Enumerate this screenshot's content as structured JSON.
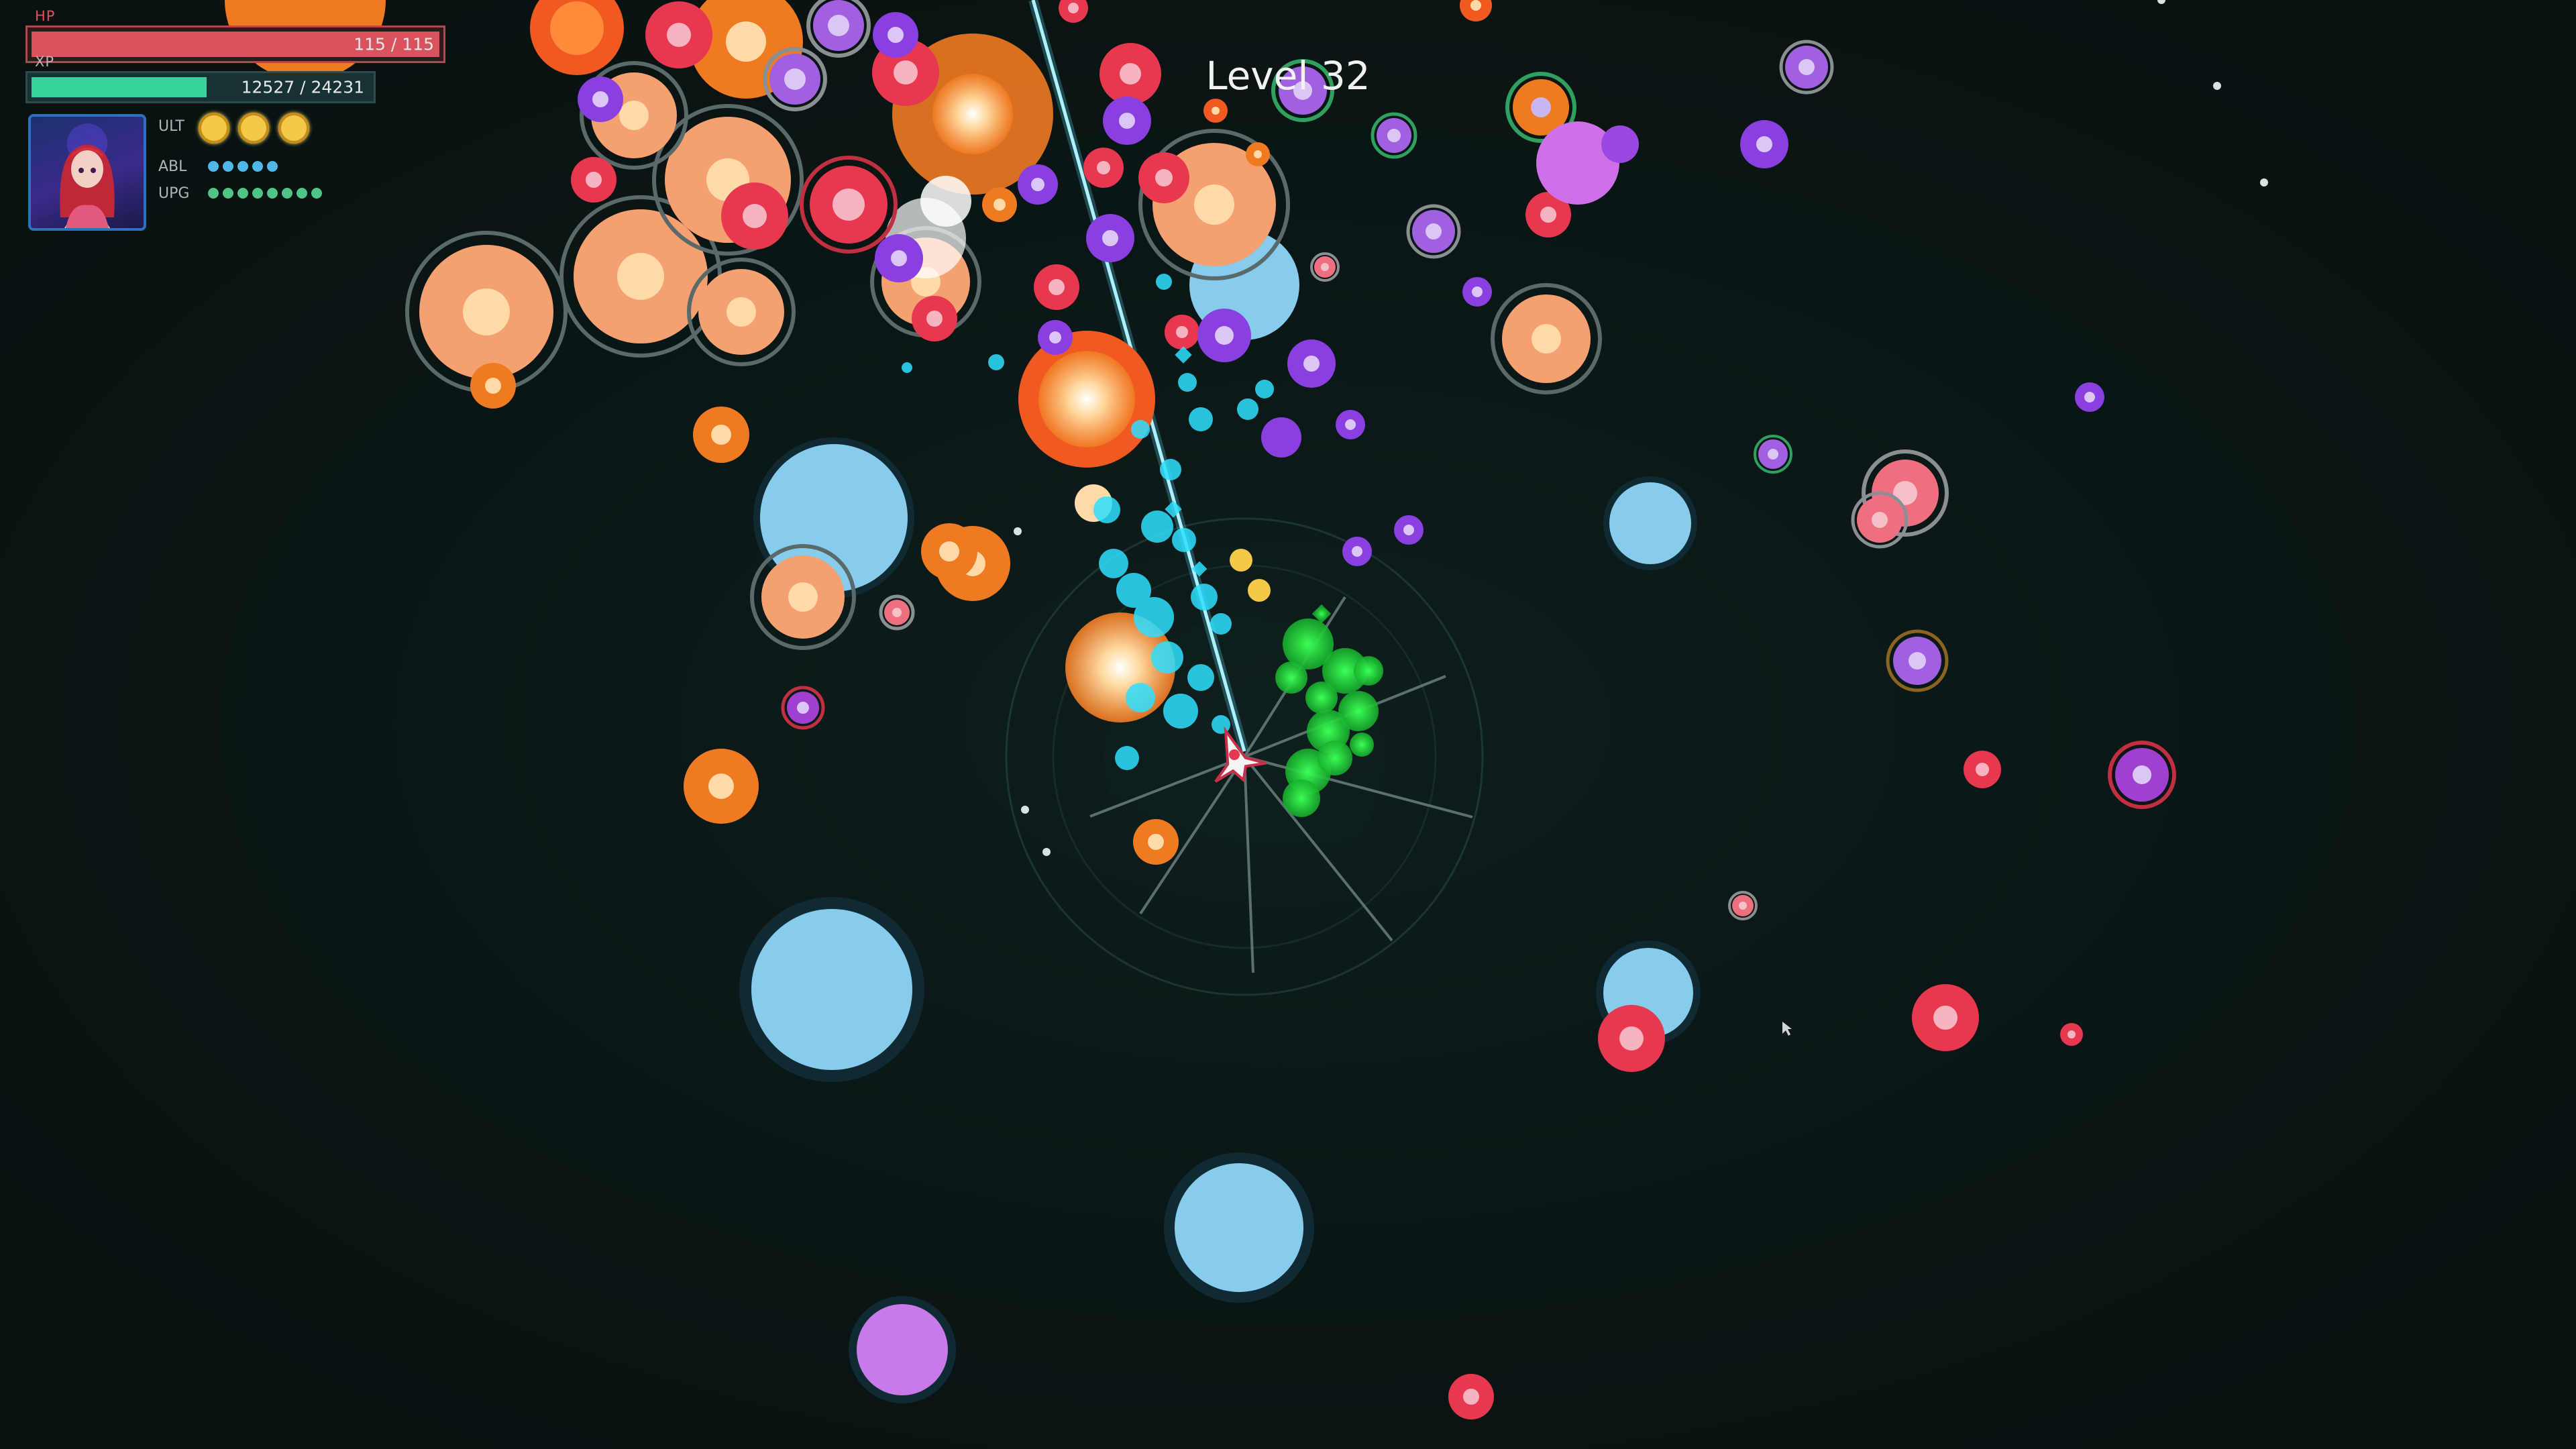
{
  "hud": {
    "hp_label": "HP",
    "hp_text": "115 / 115",
    "hp_current": 115,
    "hp_max": 115,
    "xp_label": "XP",
    "xp_text": "12527 / 24231",
    "xp_current": 12527,
    "xp_max": 24231,
    "ult_label": "ULT",
    "ult_charges": 3,
    "abl_label": "ABL",
    "abl_pips": 5,
    "upg_label": "UPG",
    "upg_pips": 8
  },
  "level_title": "Level 32",
  "colors": {
    "background": "#0b1817",
    "hp": "#d9525c",
    "xp": "#36d29a",
    "ult": "#f3c94a",
    "abl": "#4fb8e8",
    "upg": "#4fc484",
    "enemy_orange": "#f07a22",
    "enemy_red": "#e8384f",
    "enemy_purple": "#8a3fe0",
    "enemy_blue": "#87ccec",
    "enemy_violet": "#c77ae8",
    "laser": "#9eeaff",
    "shield_particles": "#2fe0ff",
    "poison_cloud": "#2ee04a"
  },
  "icons": {
    "portrait": "anime-pilot-portrait-icon",
    "player": "player-ship-icon",
    "cursor": "mouse-pointer-icon"
  }
}
